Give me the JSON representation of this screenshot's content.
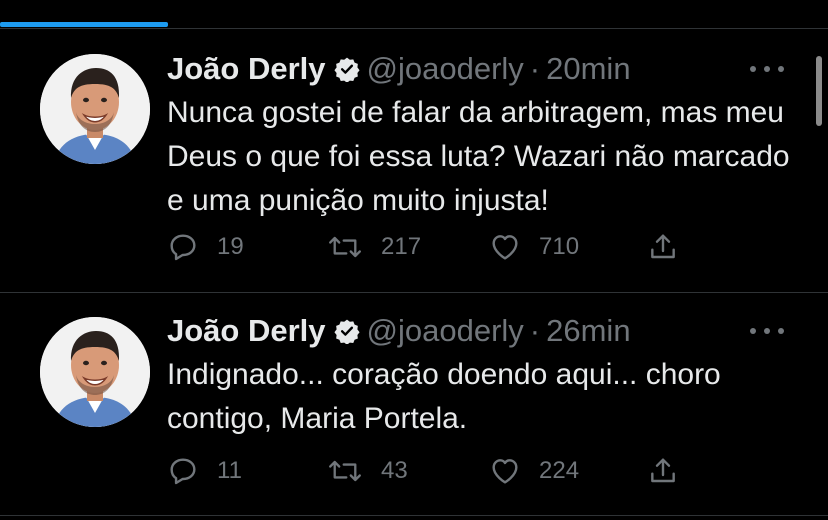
{
  "tweets": [
    {
      "author_name": "João Derly",
      "handle": "@joaoderly",
      "separator": "·",
      "time": "20min",
      "text": "Nunca gostei de falar da arbitragem, mas meu Deus o que foi essa luta? Wazari não marcado e uma punição muito injusta!",
      "replies": "19",
      "retweets": "217",
      "likes": "710"
    },
    {
      "author_name": "João Derly",
      "handle": "@joaoderly",
      "separator": "·",
      "time": "26min",
      "text": "Indignado... coração doendo aqui... choro contigo, Maria Portela.",
      "replies": "11",
      "retweets": "43",
      "likes": "224"
    }
  ],
  "icons": {
    "verified": "verified-badge-icon",
    "more": "more-options-icon",
    "reply": "reply-icon",
    "retweet": "retweet-icon",
    "like": "heart-icon",
    "share": "share-icon"
  },
  "colors": {
    "background": "#000000",
    "text": "#e7e9ea",
    "muted": "#71767b",
    "accent": "#1d9bf0",
    "divider": "#2f3336"
  }
}
